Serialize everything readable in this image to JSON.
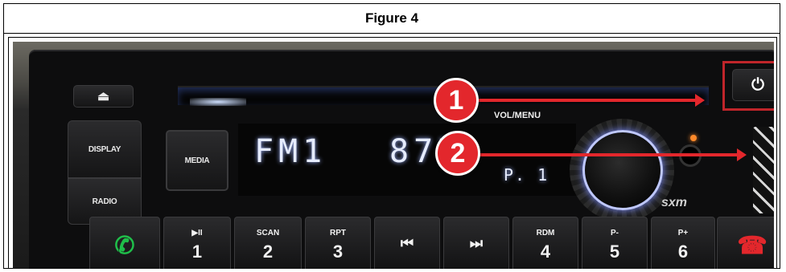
{
  "figure": {
    "title": "Figure 4"
  },
  "radio": {
    "buttons": {
      "display": "DISPLAY",
      "radio": "RADIO",
      "media": "MEDIA",
      "vol_menu": "VOL/MENU"
    },
    "lcd": {
      "band": "FM1",
      "frequency": "877",
      "preset": "P. 1"
    },
    "sxm_logo": "sxm",
    "presets": [
      {
        "top": "▶II",
        "num": "1"
      },
      {
        "top": "SCAN",
        "num": "2"
      },
      {
        "top": "RPT",
        "num": "3"
      },
      {
        "top": "⏮",
        "num": ""
      },
      {
        "top": "⏭",
        "num": ""
      },
      {
        "top": "RDM",
        "num": "4"
      },
      {
        "top": "P-",
        "num": "5"
      },
      {
        "top": "P+",
        "num": "6"
      }
    ],
    "icons": {
      "eject": "eject-icon",
      "power": "power-icon",
      "call": "phone-call-icon",
      "end_call": "phone-end-icon"
    }
  },
  "callouts": [
    {
      "label": "1"
    },
    {
      "label": "2"
    }
  ],
  "colors": {
    "callout": "#e3272c",
    "highlight_box": "#c0252a",
    "call_green": "#1fbf4a",
    "end_red": "#e3272c"
  }
}
